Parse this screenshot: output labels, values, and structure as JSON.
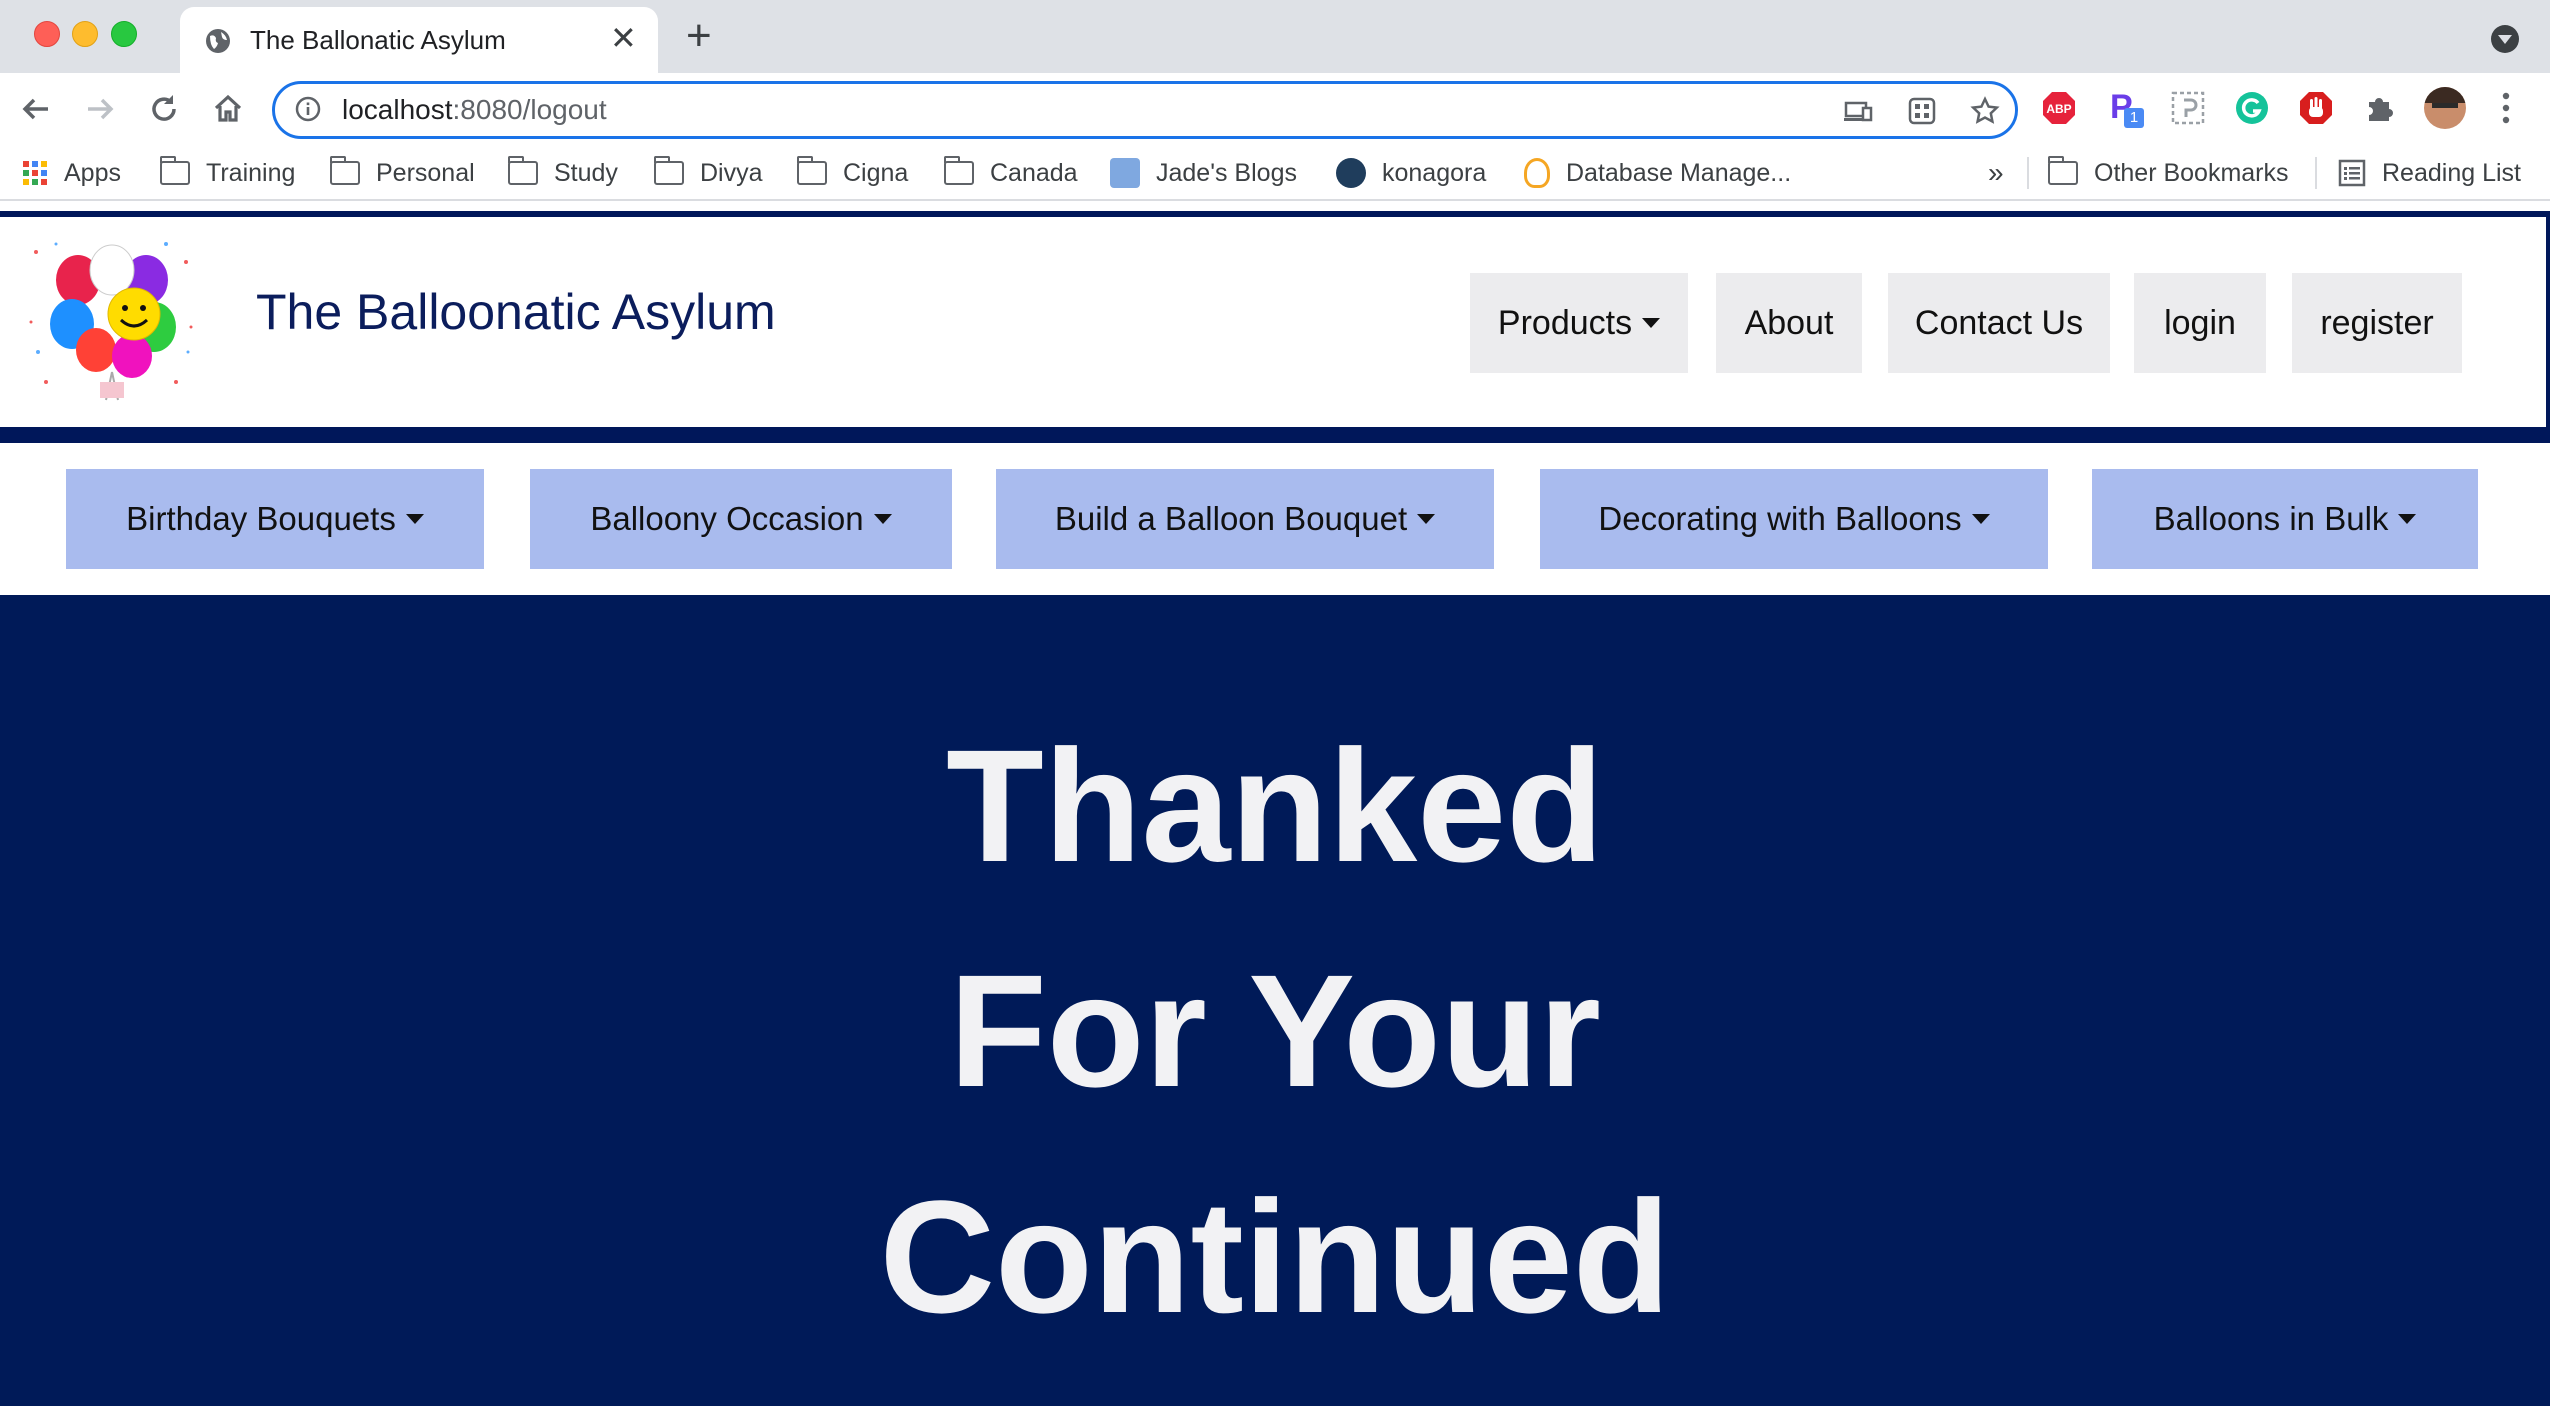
{
  "browser": {
    "tab_title": "The Ballonatic Asylum",
    "url_host": "localhost",
    "url_rest": ":8080/logout",
    "bookmarks": [
      {
        "label": "Apps",
        "icon": "apps-grid-icon"
      },
      {
        "label": "Training",
        "icon": "folder-icon"
      },
      {
        "label": "Personal",
        "icon": "folder-icon"
      },
      {
        "label": "Study",
        "icon": "folder-icon"
      },
      {
        "label": "Divya",
        "icon": "folder-icon"
      },
      {
        "label": "Cigna",
        "icon": "folder-icon"
      },
      {
        "label": "Canada",
        "icon": "folder-icon"
      },
      {
        "label": "Jade's Blogs",
        "icon": "blog-icon"
      },
      {
        "label": "konagora",
        "icon": "konagora-icon"
      },
      {
        "label": "Database Manage...",
        "icon": "database-icon"
      }
    ],
    "overflow_label": "»",
    "other_bookmarks": "Other Bookmarks",
    "reading_list": "Reading List",
    "extension_badge": "1"
  },
  "site": {
    "brand": "The Balloonatic Asylum",
    "topnav": [
      {
        "label": "Products",
        "has_caret": true
      },
      {
        "label": "About"
      },
      {
        "label": "Contact Us"
      },
      {
        "label": "login"
      },
      {
        "label": "register"
      }
    ],
    "categories": [
      {
        "label": "Birthday Bouquets"
      },
      {
        "label": "Balloony Occasion"
      },
      {
        "label": "Build a Balloon Bouquet"
      },
      {
        "label": "Decorating with Balloons"
      },
      {
        "label": "Balloons in Bulk"
      }
    ],
    "hero_lines": [
      "Thanked",
      "For Your",
      "Continued"
    ]
  },
  "colors": {
    "navy": "#00175a",
    "category_blue": "#a9bbee",
    "nav_gray": "#ececee",
    "hero_text": "#f2f2f4"
  }
}
